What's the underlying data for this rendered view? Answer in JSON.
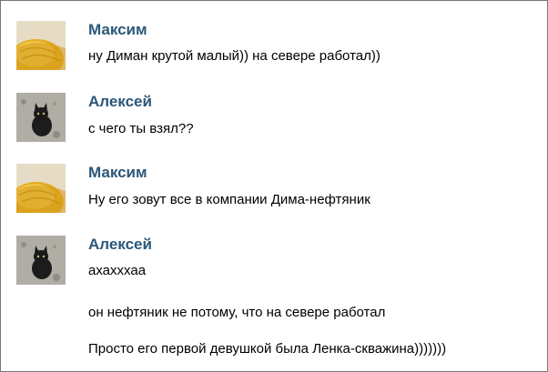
{
  "messages": [
    {
      "author": "Максим",
      "avatar": "yellow-sun-hat-avatar",
      "lines": [
        "ну Диман крутой малый)) на севере работал))"
      ]
    },
    {
      "author": "Алексей",
      "avatar": "black-cat-avatar",
      "lines": [
        "с чего ты взял??"
      ]
    },
    {
      "author": "Максим",
      "avatar": "yellow-sun-hat-avatar",
      "lines": [
        "Ну его зовут все в компании Дима-нефтяник"
      ]
    },
    {
      "author": "Алексей",
      "avatar": "black-cat-avatar",
      "lines": [
        "ахахххаа",
        "он нефтяник не потому, что на севере работал",
        "Просто его первой девушкой была Ленка-скважина)))))))"
      ]
    }
  ],
  "colors": {
    "author_name": "#2b587a",
    "text": "#000000",
    "background": "#ffffff"
  }
}
